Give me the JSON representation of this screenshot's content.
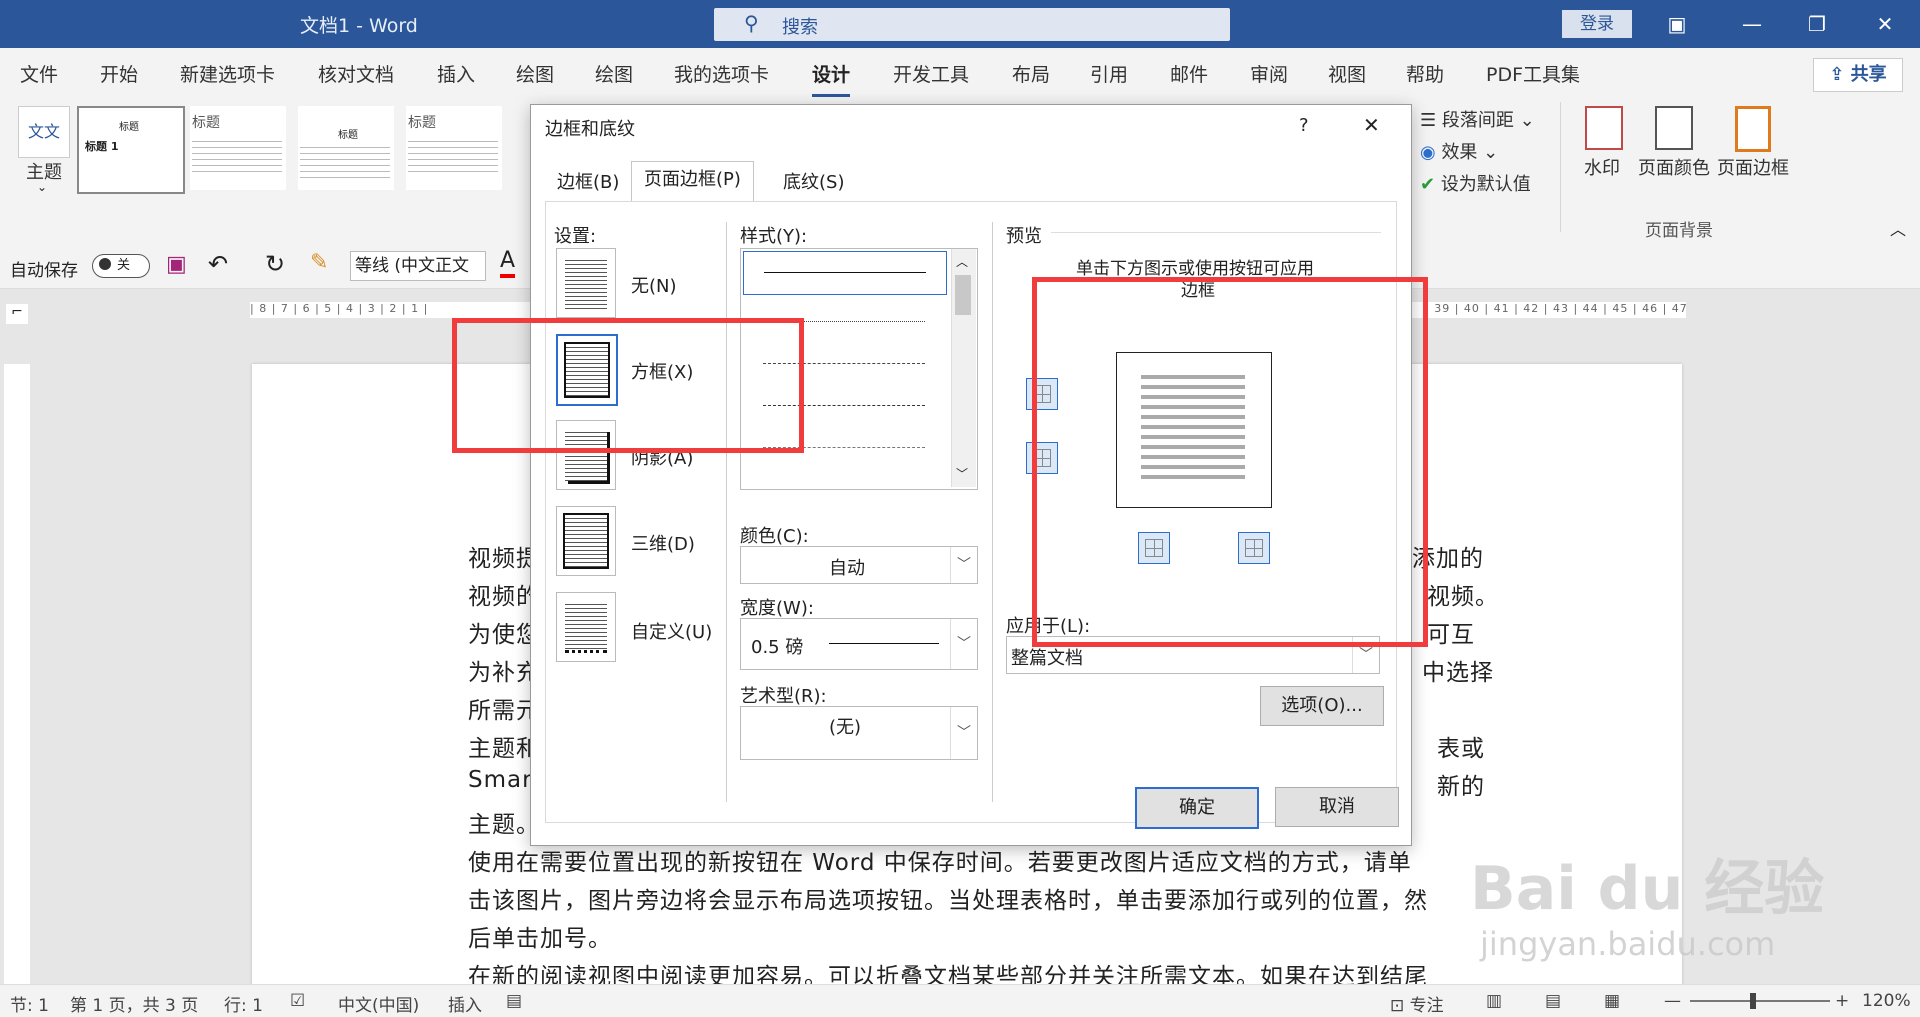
{
  "titlebar": {
    "doc_title": "文档1  -  Word",
    "search_placeholder": "搜索",
    "login": "登录"
  },
  "tabs": [
    "文件",
    "开始",
    "新建选项卡",
    "核对文档",
    "插入",
    "绘图",
    "绘图",
    "我的选项卡",
    "设计",
    "开发工具",
    "布局",
    "引用",
    "邮件",
    "审阅",
    "视图",
    "帮助",
    "PDF工具集"
  ],
  "active_tab": "设计",
  "share": "共享",
  "ribbon": {
    "theme_label": "主题",
    "gallery_titles": [
      "标题",
      "标题",
      "标题",
      "标题"
    ],
    "gallery_headings": [
      "标题 1",
      "标题 1",
      "标题 1"
    ],
    "para_spacing": "段落间距",
    "effects": "效果",
    "set_default": "设为默认值",
    "watermark": "水印",
    "page_color": "页面颜色",
    "page_border": "页面边框",
    "group_page_bg": "页面背景"
  },
  "qat": {
    "autosave": "自动保存",
    "autosave_state": "关",
    "font_name": "等线 (中文正文",
    "font_color_glyph": "A"
  },
  "ruler_text": "| 8 | 7 | 6 | 5 | 4 | 3 | 2 | 1 |",
  "ruler_text_right": "| 39 | 40 | 41 | 42 | 43 | 44 | 45 | 46 | 47 | 48",
  "document": {
    "lines": [
      "视频提",
      "视频的",
      "为使您",
      "为补充",
      "所需元",
      "主题和",
      "Smart",
      "主题。",
      "使用在需要位置出现的新按钮在 Word 中保存时间。若要更改图片适应文档的方式，请单",
      "击该图片，图片旁边将会显示布局选项按钮。当处理表格时，单击要添加行或列的位置，然",
      "后单击加号。",
      "在新的阅读视图中阅读更加容易。可以折叠文档某些部分并关注所需文本。如果在达到结尾"
    ],
    "right_fragments": [
      "添加的",
      "视频。",
      "可互",
      "中选择",
      "表或",
      "新的"
    ]
  },
  "dialog": {
    "title": "边框和底纹",
    "help": "?",
    "close": "✕",
    "tabs": [
      "边框(B)",
      "页面边框(P)",
      "底纹(S)"
    ],
    "active_tab": "页面边框(P)",
    "settings_label": "设置:",
    "settings": [
      "无(N)",
      "方框(X)",
      "阴影(A)",
      "三维(D)",
      "自定义(U)"
    ],
    "style_label": "样式(Y):",
    "color_label": "颜色(C):",
    "color_value": "自动",
    "width_label": "宽度(W):",
    "width_value": "0.5 磅",
    "art_label": "艺术型(R):",
    "art_value": "(无)",
    "preview_label": "预览",
    "preview_hint_1": "单击下方图示或使用按钮可应用",
    "preview_hint_2": "边框",
    "apply_label": "应用于(L):",
    "apply_value": "整篇文档",
    "options_btn": "选项(O)...",
    "ok_btn": "确定",
    "cancel_btn": "取消"
  },
  "statusbar": {
    "section": "节: 1",
    "page": "第 1 页，共 3 页",
    "line": "行: 1",
    "language": "中文(中国)",
    "insert": "插入",
    "focus": "专注",
    "zoom": "120%"
  },
  "watermark": {
    "brand": "Bai du 经验",
    "url": "jingyan.baidu.com"
  },
  "colors": {
    "title_bar": "#2b579a",
    "highlight_box": "#f03c3c",
    "ribbon_bg": "#f3f3f3"
  }
}
